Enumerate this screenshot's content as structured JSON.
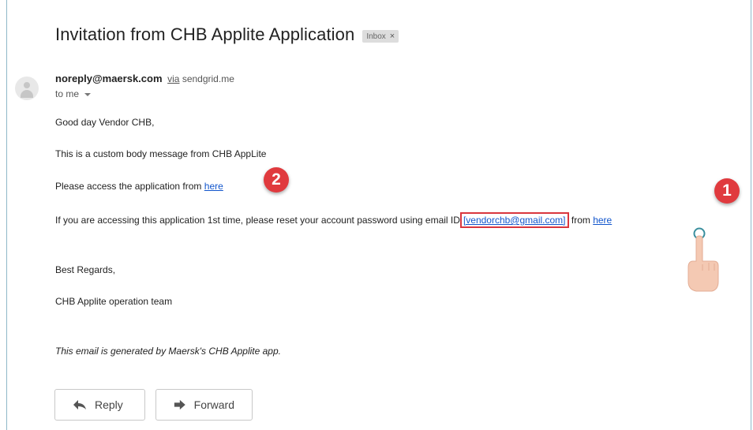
{
  "email": {
    "subject": "Invitation from CHB Applite Application",
    "label_badge": "Inbox",
    "label_remove": "×",
    "sender_email": "noreply@maersk.com",
    "via_word": "via",
    "via_domain": "sendgrid.me",
    "recipient": "to me",
    "greeting": "Good day Vendor CHB,",
    "custom_message": "This is a custom body message from CHB AppLite",
    "access_text": "Please access the application from",
    "access_link": "here",
    "reset_text": "If you are accessing this application 1st time, please reset your account password using email ID",
    "reset_email": "[vendorchb@gmail.com]",
    "reset_from": "from",
    "reset_link": "here",
    "regards": "Best Regards,",
    "team": "CHB Applite operation team",
    "footer_note": "This email is generated by Maersk's CHB Applite app."
  },
  "annotations": {
    "step1": "1",
    "step2": "2",
    "highlight_color": "#d9363e",
    "badge_color": "#e03a3e"
  },
  "actions": {
    "reply_label": "Reply",
    "forward_label": "Forward"
  },
  "icons": {
    "avatar": "person-icon",
    "reply": "reply-arrow-icon",
    "forward": "forward-arrow-icon",
    "pointer": "hand-pointer-icon",
    "caret": "chevron-down-icon"
  },
  "colors": {
    "link": "#1155cc",
    "frame_border": "#8fb8c9"
  }
}
